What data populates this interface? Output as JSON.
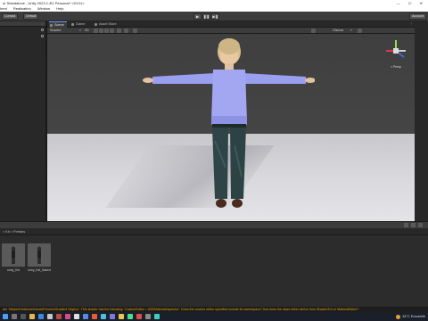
{
  "window": {
    "title": "ur Standalone - Unity 2023.1.4f1 Personal* <DX11>",
    "controls": [
      "—",
      "☐",
      "✕"
    ]
  },
  "menu": [
    "hent",
    "Realisation",
    "Window",
    "Help"
  ],
  "toolbar": {
    "left_buttons": [
      "Contact",
      "Default"
    ],
    "play": "▶",
    "pause": "❚❚",
    "step": "▶❚",
    "account": "Account"
  },
  "scene_tabs": [
    "Scene",
    "Game",
    "Asset Store"
  ],
  "scene_toolbar": {
    "shading": "Shaded",
    "mode_2d": "2D",
    "gizmos": "Gizmos"
  },
  "gizmo": {
    "persp_label": "< Persp"
  },
  "project": {
    "breadcrumb": "> Kit > Prefabs",
    "assets": [
      {
        "label": "ooby_Kid"
      },
      {
        "label": "ooby_Kid_Baked"
      }
    ]
  },
  "status_bar": {
    "message": "der 'Hidden/HebbonsGamesPrevers/Gradient Skybox'. This shader has the following: 'CustomEditor = ASEMaterialInspector'. Does the custom editor specified include its namespace? And does the class either derive from ShaderGUI or MaterialEditor?"
  },
  "taskbar": {
    "weather": "34°C  Ensoleillé"
  },
  "colors": {
    "editor_bg": "#282828",
    "toolbar_bg": "#3c3c3c",
    "accent": "#6aa0ff",
    "warning": "#e8a000"
  }
}
